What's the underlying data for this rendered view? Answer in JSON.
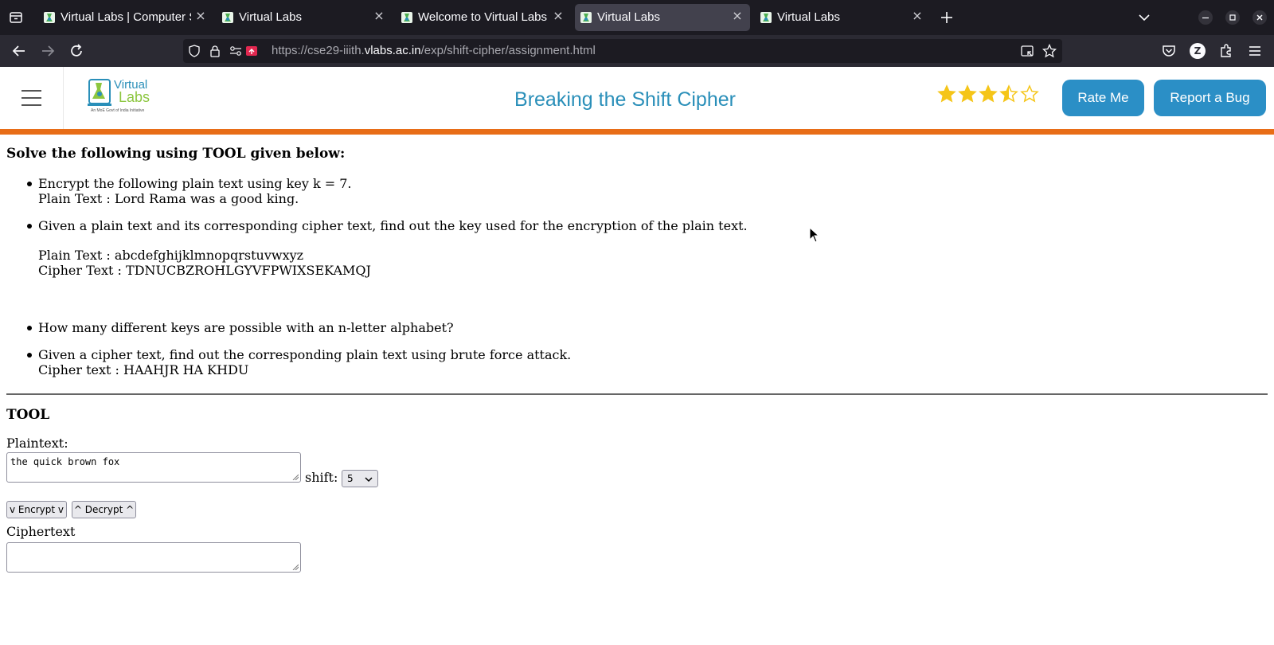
{
  "browser": {
    "tabs": [
      {
        "title": "Virtual Labs | Computer S",
        "active": false
      },
      {
        "title": "Virtual Labs",
        "active": false
      },
      {
        "title": "Welcome to Virtual Labs",
        "active": false
      },
      {
        "title": "Virtual Labs",
        "active": true
      },
      {
        "title": "Virtual Labs",
        "active": false
      }
    ],
    "url": {
      "prefix": "https://cse29-iiith.",
      "host": "vlabs.ac.in",
      "path": "/exp/shift-cipher/assignment.html"
    },
    "profile_initial": "Z",
    "colors": {
      "tabstrip": "#1c1b22",
      "toolbar": "#2b2a33",
      "active_tab": "#42414d"
    }
  },
  "site": {
    "logo": {
      "line1": "Virtual",
      "line2": "Labs",
      "tagline": "An MoE Govt of India Initiative"
    },
    "title": "Breaking the Shift Cipher",
    "rating": {
      "value": 3.5,
      "max": 5
    },
    "rate_button": "Rate Me",
    "bug_button": "Report a Bug",
    "colors": {
      "accent": "#2b8fc6",
      "title": "#2a8fb9",
      "bar": "#e86d17",
      "star": "#f5c518"
    }
  },
  "assignment": {
    "instruction": "Solve the following using TOOL given below:",
    "items": [
      {
        "lines": [
          "Encrypt the following plain text using key k = 7.",
          "Plain Text : Lord Rama was a good king."
        ]
      },
      {
        "lines": [
          "Given a plain text and its corresponding cipher text, find out the key used for the encryption of the plain text.",
          "Plain Text : abcdefghijklmnopqrstuvwxyz",
          "Cipher Text : TDNUCBZROHLGYVFPWIXSEKAMQJ"
        ]
      },
      {
        "lines": [
          "How many different keys are possible with an n-letter alphabet?"
        ]
      },
      {
        "lines": [
          "Given a cipher text, find out the corresponding plain text using brute force attack.",
          "Cipher text : HAAHJR HA KHDU"
        ]
      }
    ]
  },
  "tool": {
    "heading": "TOOL",
    "plaintext_label": "Plaintext:",
    "plaintext_value": "the quick brown fox",
    "shift_label": "shift:",
    "shift_value": "5",
    "encrypt_button": "v Encrypt v",
    "decrypt_button": "^ Decrypt ^",
    "ciphertext_label": "Ciphertext",
    "ciphertext_value": ""
  }
}
